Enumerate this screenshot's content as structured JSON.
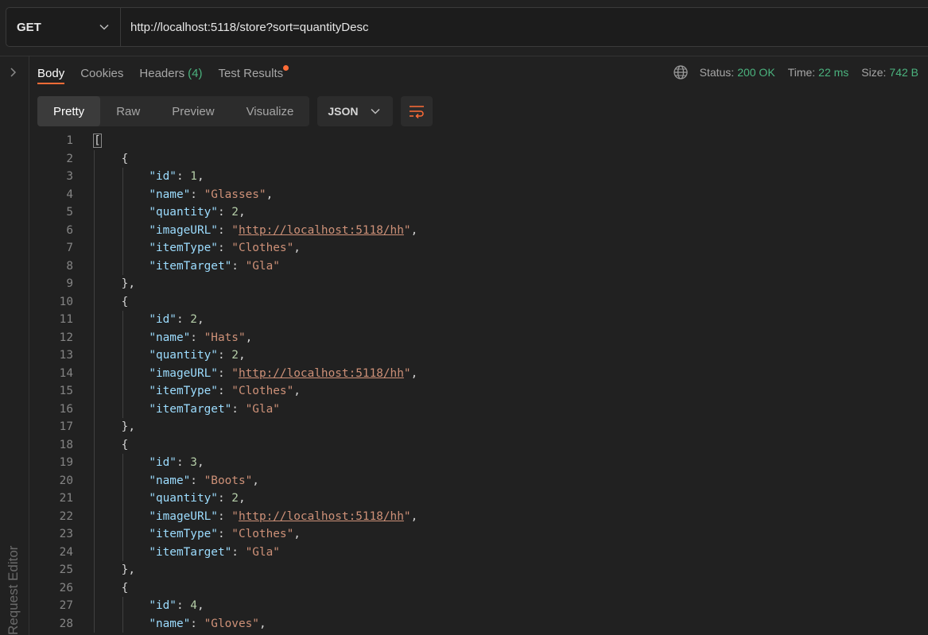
{
  "request": {
    "method": "GET",
    "url": "http://localhost:5118/store?sort=quantityDesc"
  },
  "side_panel": {
    "label": "Request Editor"
  },
  "response_tabs": [
    {
      "label": "Body",
      "active": true
    },
    {
      "label": "Cookies"
    },
    {
      "label": "Headers",
      "count": "(4)"
    },
    {
      "label": "Test Results",
      "has_dot": true
    }
  ],
  "status": {
    "status_label": "Status:",
    "status_value": "200 OK",
    "time_label": "Time:",
    "time_value": "22 ms",
    "size_label": "Size:",
    "size_value": "742 B"
  },
  "view_modes": [
    "Pretty",
    "Raw",
    "Preview",
    "Visualize"
  ],
  "active_view": "Pretty",
  "format": "JSON",
  "colors": {
    "accent": "#ff6c37",
    "success": "#4bb37e",
    "key": "#9cdcfe",
    "string": "#ce9178",
    "number": "#b5cea8"
  },
  "icons": [
    "chevron-down-icon",
    "chevron-right-icon",
    "globe-icon",
    "wrap-lines-icon"
  ],
  "code_lines": [
    [
      {
        "t": "p",
        "v": "["
      }
    ],
    [
      {
        "t": "p",
        "v": "    {"
      }
    ],
    [
      {
        "t": "p",
        "v": "        "
      },
      {
        "t": "key",
        "v": "\"id\""
      },
      {
        "t": "p",
        "v": ": "
      },
      {
        "t": "num",
        "v": "1"
      },
      {
        "t": "p",
        "v": ","
      }
    ],
    [
      {
        "t": "p",
        "v": "        "
      },
      {
        "t": "key",
        "v": "\"name\""
      },
      {
        "t": "p",
        "v": ": "
      },
      {
        "t": "str",
        "v": "\"Glasses\""
      },
      {
        "t": "p",
        "v": ","
      }
    ],
    [
      {
        "t": "p",
        "v": "        "
      },
      {
        "t": "key",
        "v": "\"quantity\""
      },
      {
        "t": "p",
        "v": ": "
      },
      {
        "t": "num",
        "v": "2"
      },
      {
        "t": "p",
        "v": ","
      }
    ],
    [
      {
        "t": "p",
        "v": "        "
      },
      {
        "t": "key",
        "v": "\"imageURL\""
      },
      {
        "t": "p",
        "v": ": "
      },
      {
        "t": "str",
        "v": "\""
      },
      {
        "t": "link",
        "v": "http://localhost:5118/hh"
      },
      {
        "t": "str",
        "v": "\""
      },
      {
        "t": "p",
        "v": ","
      }
    ],
    [
      {
        "t": "p",
        "v": "        "
      },
      {
        "t": "key",
        "v": "\"itemType\""
      },
      {
        "t": "p",
        "v": ": "
      },
      {
        "t": "str",
        "v": "\"Clothes\""
      },
      {
        "t": "p",
        "v": ","
      }
    ],
    [
      {
        "t": "p",
        "v": "        "
      },
      {
        "t": "key",
        "v": "\"itemTarget\""
      },
      {
        "t": "p",
        "v": ": "
      },
      {
        "t": "str",
        "v": "\"Gla\""
      }
    ],
    [
      {
        "t": "p",
        "v": "    },"
      }
    ],
    [
      {
        "t": "p",
        "v": "    {"
      }
    ],
    [
      {
        "t": "p",
        "v": "        "
      },
      {
        "t": "key",
        "v": "\"id\""
      },
      {
        "t": "p",
        "v": ": "
      },
      {
        "t": "num",
        "v": "2"
      },
      {
        "t": "p",
        "v": ","
      }
    ],
    [
      {
        "t": "p",
        "v": "        "
      },
      {
        "t": "key",
        "v": "\"name\""
      },
      {
        "t": "p",
        "v": ": "
      },
      {
        "t": "str",
        "v": "\"Hats\""
      },
      {
        "t": "p",
        "v": ","
      }
    ],
    [
      {
        "t": "p",
        "v": "        "
      },
      {
        "t": "key",
        "v": "\"quantity\""
      },
      {
        "t": "p",
        "v": ": "
      },
      {
        "t": "num",
        "v": "2"
      },
      {
        "t": "p",
        "v": ","
      }
    ],
    [
      {
        "t": "p",
        "v": "        "
      },
      {
        "t": "key",
        "v": "\"imageURL\""
      },
      {
        "t": "p",
        "v": ": "
      },
      {
        "t": "str",
        "v": "\""
      },
      {
        "t": "link",
        "v": "http://localhost:5118/hh"
      },
      {
        "t": "str",
        "v": "\""
      },
      {
        "t": "p",
        "v": ","
      }
    ],
    [
      {
        "t": "p",
        "v": "        "
      },
      {
        "t": "key",
        "v": "\"itemType\""
      },
      {
        "t": "p",
        "v": ": "
      },
      {
        "t": "str",
        "v": "\"Clothes\""
      },
      {
        "t": "p",
        "v": ","
      }
    ],
    [
      {
        "t": "p",
        "v": "        "
      },
      {
        "t": "key",
        "v": "\"itemTarget\""
      },
      {
        "t": "p",
        "v": ": "
      },
      {
        "t": "str",
        "v": "\"Gla\""
      }
    ],
    [
      {
        "t": "p",
        "v": "    },"
      }
    ],
    [
      {
        "t": "p",
        "v": "    {"
      }
    ],
    [
      {
        "t": "p",
        "v": "        "
      },
      {
        "t": "key",
        "v": "\"id\""
      },
      {
        "t": "p",
        "v": ": "
      },
      {
        "t": "num",
        "v": "3"
      },
      {
        "t": "p",
        "v": ","
      }
    ],
    [
      {
        "t": "p",
        "v": "        "
      },
      {
        "t": "key",
        "v": "\"name\""
      },
      {
        "t": "p",
        "v": ": "
      },
      {
        "t": "str",
        "v": "\"Boots\""
      },
      {
        "t": "p",
        "v": ","
      }
    ],
    [
      {
        "t": "p",
        "v": "        "
      },
      {
        "t": "key",
        "v": "\"quantity\""
      },
      {
        "t": "p",
        "v": ": "
      },
      {
        "t": "num",
        "v": "2"
      },
      {
        "t": "p",
        "v": ","
      }
    ],
    [
      {
        "t": "p",
        "v": "        "
      },
      {
        "t": "key",
        "v": "\"imageURL\""
      },
      {
        "t": "p",
        "v": ": "
      },
      {
        "t": "str",
        "v": "\""
      },
      {
        "t": "link",
        "v": "http://localhost:5118/hh"
      },
      {
        "t": "str",
        "v": "\""
      },
      {
        "t": "p",
        "v": ","
      }
    ],
    [
      {
        "t": "p",
        "v": "        "
      },
      {
        "t": "key",
        "v": "\"itemType\""
      },
      {
        "t": "p",
        "v": ": "
      },
      {
        "t": "str",
        "v": "\"Clothes\""
      },
      {
        "t": "p",
        "v": ","
      }
    ],
    [
      {
        "t": "p",
        "v": "        "
      },
      {
        "t": "key",
        "v": "\"itemTarget\""
      },
      {
        "t": "p",
        "v": ": "
      },
      {
        "t": "str",
        "v": "\"Gla\""
      }
    ],
    [
      {
        "t": "p",
        "v": "    },"
      }
    ],
    [
      {
        "t": "p",
        "v": "    {"
      }
    ],
    [
      {
        "t": "p",
        "v": "        "
      },
      {
        "t": "key",
        "v": "\"id\""
      },
      {
        "t": "p",
        "v": ": "
      },
      {
        "t": "num",
        "v": "4"
      },
      {
        "t": "p",
        "v": ","
      }
    ],
    [
      {
        "t": "p",
        "v": "        "
      },
      {
        "t": "key",
        "v": "\"name\""
      },
      {
        "t": "p",
        "v": ": "
      },
      {
        "t": "str",
        "v": "\"Gloves\""
      },
      {
        "t": "p",
        "v": ","
      }
    ]
  ]
}
